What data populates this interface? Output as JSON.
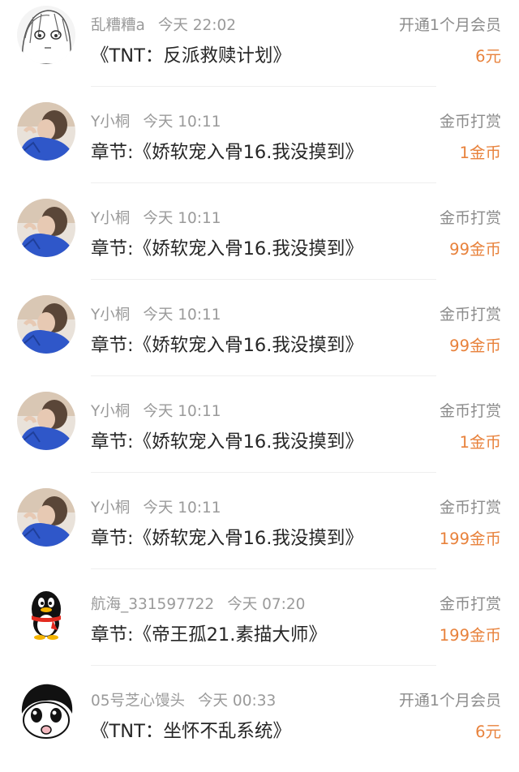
{
  "records": [
    {
      "user": "乱糟糟a",
      "time": "今天 22:02",
      "type": "开通1个月会员",
      "title": "《TNT：反派救赎计划》",
      "amount": "6元",
      "avatar": "sketch-girl-avatar"
    },
    {
      "user": "Y小桐",
      "time": "今天 10:11",
      "type": "金币打赏",
      "title": "章节:《娇软宠入骨16.我没摸到》",
      "amount": "1金币",
      "avatar": "photo-girl-avatar"
    },
    {
      "user": "Y小桐",
      "time": "今天 10:11",
      "type": "金币打赏",
      "title": "章节:《娇软宠入骨16.我没摸到》",
      "amount": "99金币",
      "avatar": "photo-girl-avatar"
    },
    {
      "user": "Y小桐",
      "time": "今天 10:11",
      "type": "金币打赏",
      "title": "章节:《娇软宠入骨16.我没摸到》",
      "amount": "99金币",
      "avatar": "photo-girl-avatar"
    },
    {
      "user": "Y小桐",
      "time": "今天 10:11",
      "type": "金币打赏",
      "title": "章节:《娇软宠入骨16.我没摸到》",
      "amount": "1金币",
      "avatar": "photo-girl-avatar"
    },
    {
      "user": "Y小桐",
      "time": "今天 10:11",
      "type": "金币打赏",
      "title": "章节:《娇软宠入骨16.我没摸到》",
      "amount": "199金币",
      "avatar": "photo-girl-avatar"
    },
    {
      "user": "航海_331597722",
      "time": "今天 07:20",
      "type": "金币打赏",
      "title": "章节:《帝王孤21.素描大师》",
      "amount": "199金币",
      "avatar": "qq-penguin-avatar"
    },
    {
      "user": "05号芝心馒头",
      "time": "今天 00:33",
      "type": "开通1个月会员",
      "title": "《TNT：坐怀不乱系统》",
      "amount": "6元",
      "avatar": "cartoon-face-avatar"
    }
  ],
  "colors": {
    "amount": "#e8823c",
    "meta": "#9a9a9a",
    "title": "#262626",
    "avatar_bg": "#2f57c9"
  }
}
